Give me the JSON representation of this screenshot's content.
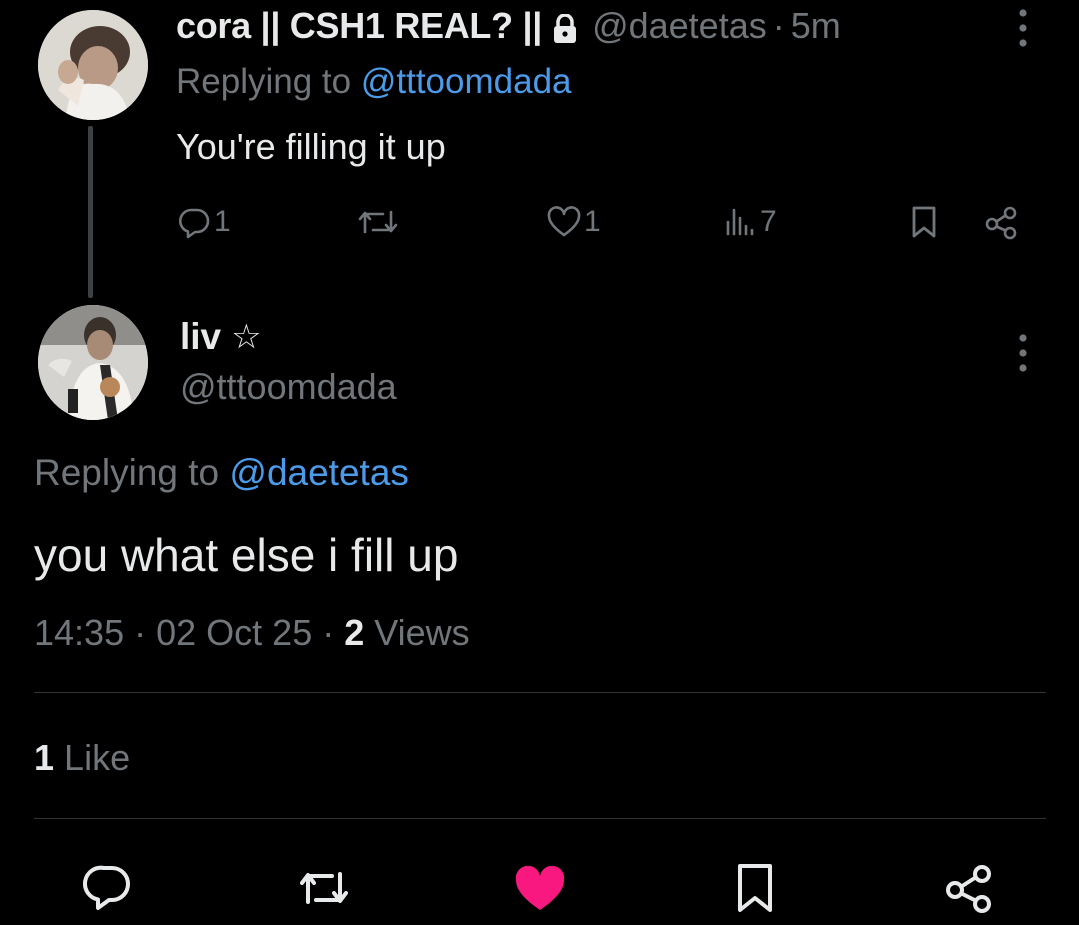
{
  "colors": {
    "background": "#000000",
    "text_primary": "#e7e9ea",
    "text_secondary": "#71767b",
    "mention": "#4c9be8",
    "liked": "#f91880"
  },
  "parent_tweet": {
    "display_name": "cora || CSH1 REAL? ||",
    "protected_icon": "lock-icon",
    "handle": "@daetetas",
    "separator": "·",
    "time": "5m",
    "replying_prefix": "Replying to",
    "replying_to": "@tttoomdada",
    "text": "You're filling it up",
    "actions": {
      "reply_count": "1",
      "retweet_count": "",
      "like_count": "1",
      "views_count": "7"
    }
  },
  "main_tweet": {
    "display_name": "liv",
    "name_symbol": "☆",
    "handle": "@tttoomdada",
    "replying_prefix": "Replying to",
    "replying_to": "@daetetas",
    "text": "you what else i fill up",
    "time": "14:35",
    "date": "02 Oct 25",
    "separator": "·",
    "views_count": "2",
    "views_label": "Views",
    "likes_count": "1",
    "likes_label": "Like",
    "liked": true
  }
}
